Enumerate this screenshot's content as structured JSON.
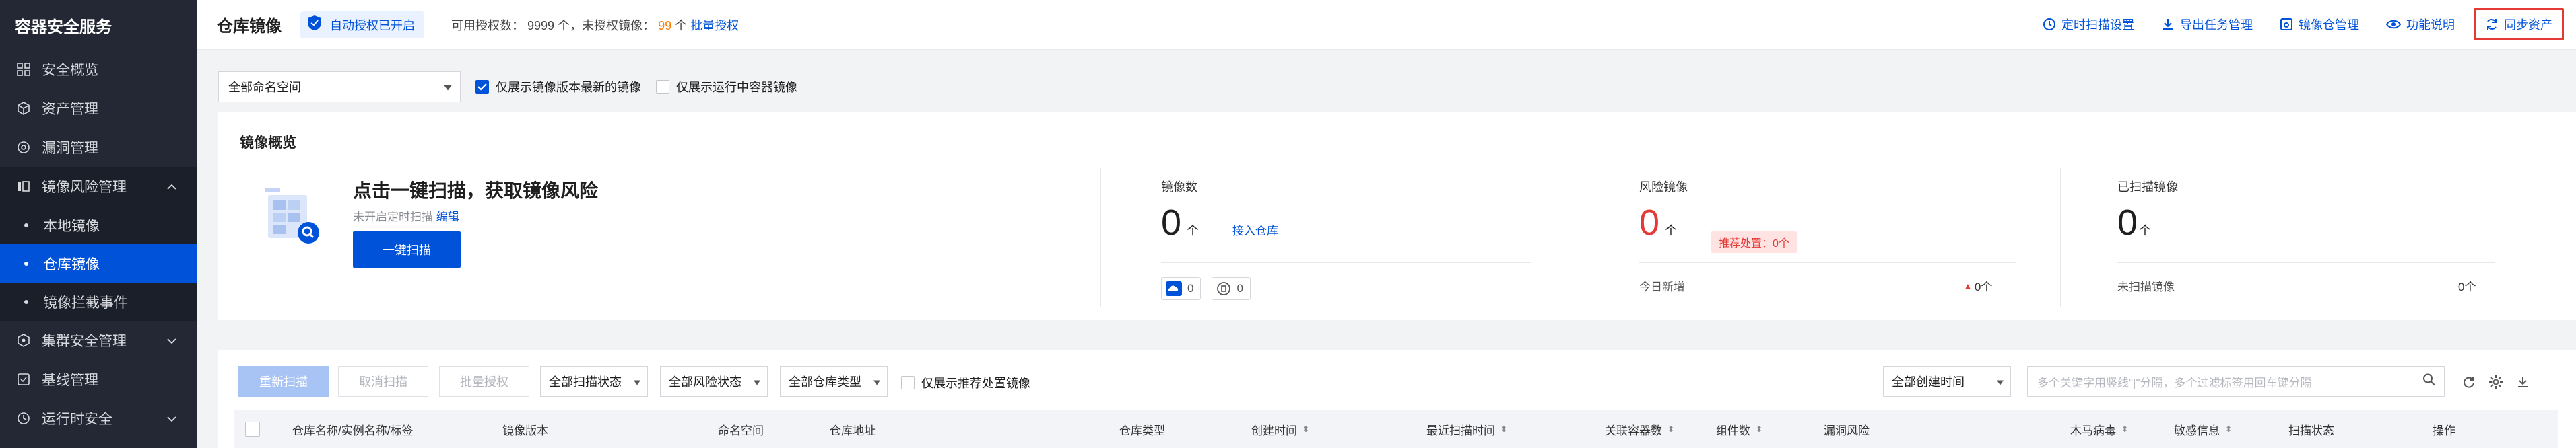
{
  "sidebar": {
    "brand": "容器安全服务",
    "items": [
      {
        "label": "安全概览",
        "icon": "grid-icon"
      },
      {
        "label": "资产管理",
        "icon": "cube-icon"
      },
      {
        "label": "漏洞管理",
        "icon": "bug-icon"
      },
      {
        "label": "镜像风险管理",
        "icon": "image-risk-icon",
        "expanded": true
      },
      {
        "label": "集群安全管理",
        "icon": "cluster-icon"
      },
      {
        "label": "基线管理",
        "icon": "baseline-icon"
      },
      {
        "label": "运行时安全",
        "icon": "runtime-icon"
      }
    ],
    "sub_items": [
      {
        "label": "本地镜像"
      },
      {
        "label": "仓库镜像",
        "active": true
      },
      {
        "label": "镜像拦截事件"
      }
    ]
  },
  "header": {
    "title": "仓库镜像",
    "auth_badge": "自动授权已开启",
    "quota_label": "可用授权数：",
    "quota_value": "9999 个",
    "unauth_label": "，未授权镜像：",
    "unauth_value": "99",
    "unauth_unit": "个",
    "batch_auth": "批量授权",
    "actions": [
      {
        "label": "定时扫描设置",
        "icon": "clock-icon"
      },
      {
        "label": "导出任务管理",
        "icon": "download-icon"
      },
      {
        "label": "镜像仓管理",
        "icon": "repo-icon"
      },
      {
        "label": "功能说明",
        "icon": "eye-icon"
      },
      {
        "label": "同步资产",
        "icon": "sync-icon"
      }
    ]
  },
  "filters": {
    "namespace": "全部命名空间",
    "show_latest": "仅展示镜像版本最新的镜像",
    "show_latest_checked": true,
    "show_running": "仅展示运行中容器镜像",
    "show_running_checked": false
  },
  "overview": {
    "title": "镜像概览",
    "cta_title": "点击一键扫描，获取镜像风险",
    "cta_sub": "未开启定时扫描",
    "cta_edit": "编辑",
    "cta_button": "一键扫描",
    "images": {
      "label": "镜像数",
      "value": "0",
      "unit": "个",
      "link": "接入仓库",
      "chip1": "0",
      "chip2": "0"
    },
    "risk": {
      "label": "风险镜像",
      "value": "0",
      "unit": "个",
      "tag": "推荐处置：0个",
      "foot_label": "今日新增",
      "foot_value": "0个",
      "foot_arrow": "▲"
    },
    "scanned": {
      "label": "已扫描镜像",
      "value": "0",
      "unit": "个",
      "foot_label": "未扫描镜像",
      "foot_value": "0个"
    }
  },
  "toolbar": {
    "rescan": "重新扫描",
    "cancel_scan": "取消扫描",
    "batch_auth": "批量授权",
    "scan_status": "全部扫描状态",
    "risk_status": "全部风险状态",
    "repo_type": "全部仓库类型",
    "show_recommended": "仅展示推荐处置镜像",
    "created_time": "全部创建时间",
    "search_placeholder": "多个关键字用竖线\"|\"分隔，多个过滤标签用回车键分隔"
  },
  "table": {
    "columns": [
      {
        "label": "仓库名称/实例名称/标签"
      },
      {
        "label": "镜像版本"
      },
      {
        "label": "命名空间"
      },
      {
        "label": "仓库地址"
      },
      {
        "label": "仓库类型"
      },
      {
        "label": "创建时间",
        "sortable": true
      },
      {
        "label": "最近扫描时间",
        "sortable": true
      },
      {
        "label": "关联容器数",
        "sortable": true
      },
      {
        "label": "组件数",
        "sortable": true
      },
      {
        "label": "漏洞风险"
      },
      {
        "label": "木马病毒",
        "sortable": true
      },
      {
        "label": "敏感信息",
        "sortable": true
      },
      {
        "label": "扫描状态"
      },
      {
        "label": "操作"
      }
    ]
  },
  "colors": {
    "primary": "#0052d9",
    "sidebar_bg": "#232834",
    "danger": "#e53935",
    "warning": "#ff7d00"
  }
}
